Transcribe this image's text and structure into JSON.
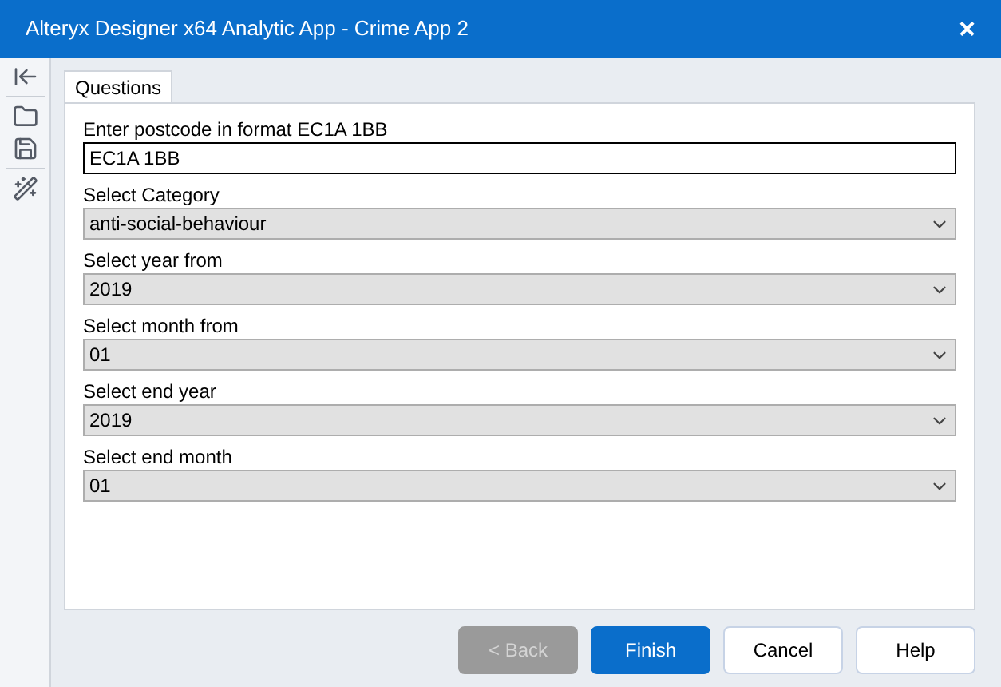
{
  "window": {
    "title": "Alteryx Designer x64 Analytic App - Crime App 2",
    "close": "×"
  },
  "tabs": [
    {
      "label": "Questions",
      "selected": true
    }
  ],
  "questions": [
    {
      "kind": "text",
      "label": "Enter postcode in format EC1A 1BB",
      "value": "EC1A 1BB"
    },
    {
      "kind": "dropdown",
      "label": "Select Category",
      "value": "anti-social-behaviour"
    },
    {
      "kind": "dropdown",
      "label": "Select year from",
      "value": "2019"
    },
    {
      "kind": "dropdown",
      "label": "Select month from",
      "value": "01"
    },
    {
      "kind": "dropdown",
      "label": "Select end year",
      "value": "2019"
    },
    {
      "kind": "dropdown",
      "label": "Select end month",
      "value": "01"
    }
  ],
  "buttons": [
    {
      "label": "< Back",
      "kind": "secondary",
      "disabled": true
    },
    {
      "label": "Finish",
      "kind": "primary",
      "disabled": false
    },
    {
      "label": "Cancel",
      "kind": "secondary",
      "disabled": false
    },
    {
      "label": "Help",
      "kind": "secondary",
      "disabled": false
    }
  ]
}
